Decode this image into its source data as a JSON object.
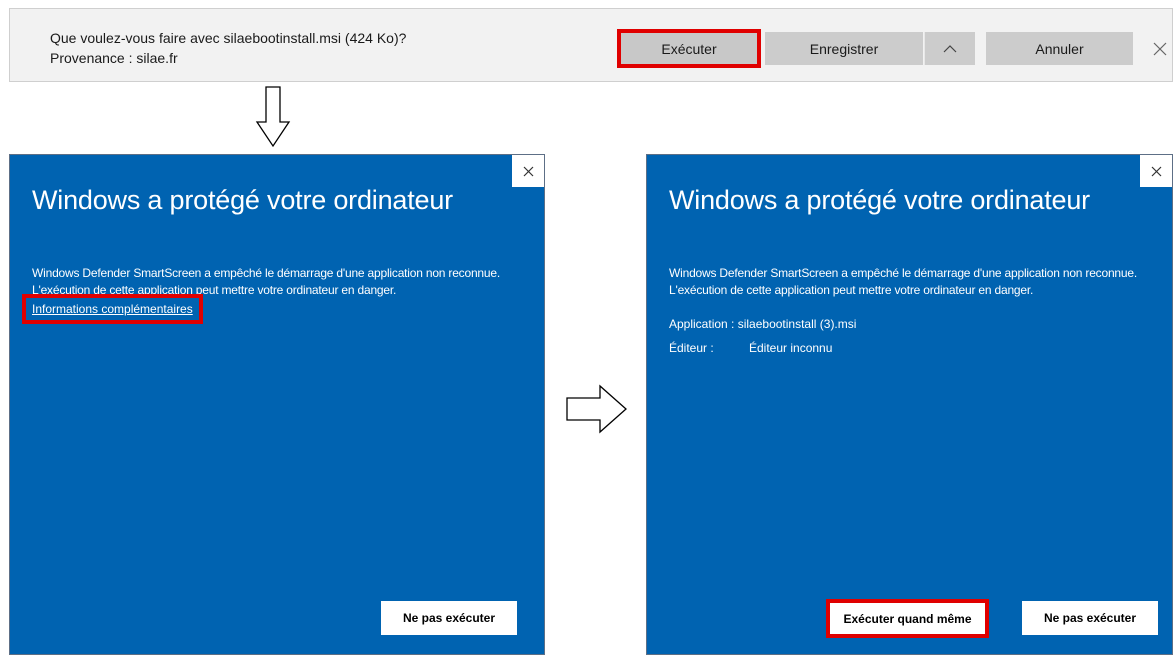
{
  "download_bar": {
    "message": "Que voulez-vous faire avec silaebootinstall.msi (424 Ko)?",
    "source": "Provenance : silae.fr",
    "run_label": "Exécuter",
    "save_label": "Enregistrer",
    "cancel_label": "Annuler",
    "icons": [
      "chevron-up-icon",
      "close-icon"
    ]
  },
  "dialog_left": {
    "title": "Windows a protégé votre ordinateur",
    "body": "Windows Defender SmartScreen a empêché le démarrage d'une application non reconnue. L'exécution de cette application peut mettre votre ordinateur en danger.",
    "more_info_link": "Informations complémentaires",
    "dont_run_label": "Ne pas exécuter"
  },
  "dialog_right": {
    "title": "Windows a protégé votre ordinateur",
    "body": "Windows Defender SmartScreen a empêché le démarrage d'une application non reconnue. L'exécution de cette application peut mettre votre ordinateur en danger.",
    "app_label": "Application :",
    "app_value": "silaebootinstall (3).msi",
    "publisher_label": "Éditeur :",
    "publisher_value": "Éditeur inconnu",
    "run_anyway_label": "Exécuter quand même",
    "dont_run_label": "Ne pas exécuter"
  },
  "colors": {
    "dialog_bg": "#0063b1",
    "highlight": "#e00000",
    "button_gray": "#cccccc"
  }
}
